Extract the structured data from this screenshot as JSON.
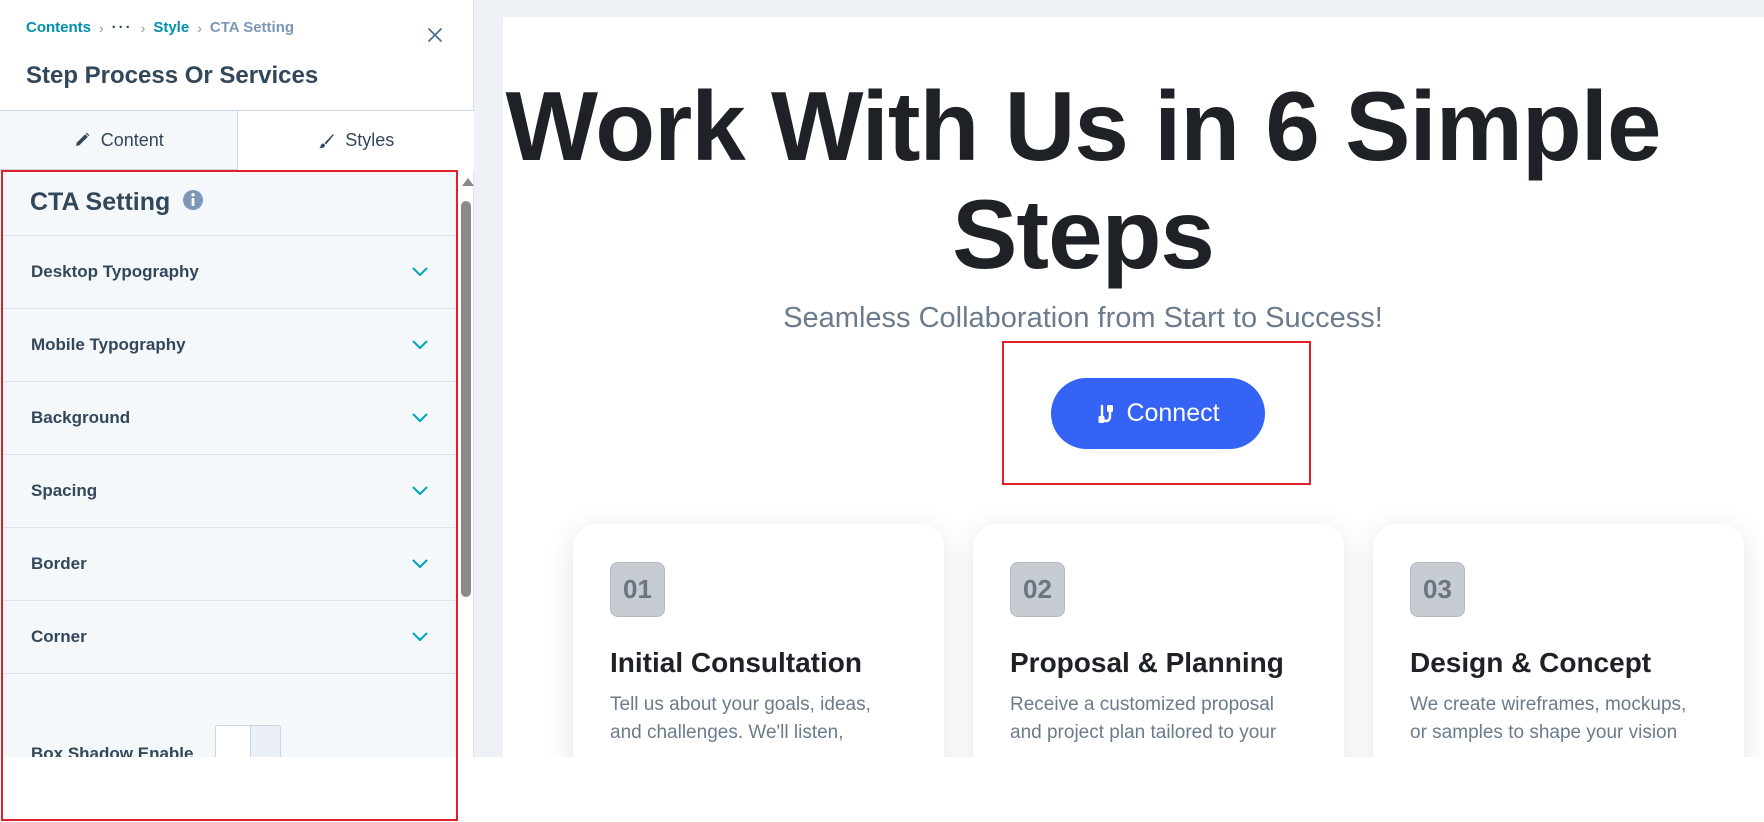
{
  "breadcrumb": {
    "contents": "Contents",
    "ellipsis": "···",
    "style": "Style",
    "current": "CTA Setting"
  },
  "panel": {
    "title": "Step Process Or Services",
    "close_icon": "close-icon"
  },
  "tabs": [
    {
      "label": "Content",
      "icon": "pencil-icon",
      "active": false
    },
    {
      "label": "Styles",
      "icon": "brush-icon",
      "active": true
    }
  ],
  "settings": {
    "header": "CTA Setting",
    "info_icon": "info-icon",
    "accordion": [
      {
        "label": "Desktop Typography"
      },
      {
        "label": "Mobile Typography"
      },
      {
        "label": "Background"
      },
      {
        "label": "Spacing"
      },
      {
        "label": "Border"
      },
      {
        "label": "Corner"
      }
    ],
    "box_shadow": {
      "label": "Box Shadow Enable",
      "enabled": false
    }
  },
  "preview": {
    "title": "Work With Us in 6 Simple Steps",
    "subtitle": "Seamless Collaboration from Start to Success!",
    "cta_label": "Connect",
    "cta_icon": "connect-icon",
    "cards": [
      {
        "num": "01",
        "title": "Initial Consultation",
        "desc": "Tell us about your goals, ideas, and challenges. We'll listen,"
      },
      {
        "num": "02",
        "title": "Proposal & Planning",
        "desc": "Receive a customized proposal and project plan tailored to your"
      },
      {
        "num": "03",
        "title": "Design & Concept",
        "desc": "We create wireframes, mockups, or samples to shape your vision"
      }
    ]
  },
  "colors": {
    "accent_teal": "#0091ae",
    "text_dark": "#33475b",
    "cta_blue": "#3563f5",
    "highlight_red": "#e0202a"
  }
}
